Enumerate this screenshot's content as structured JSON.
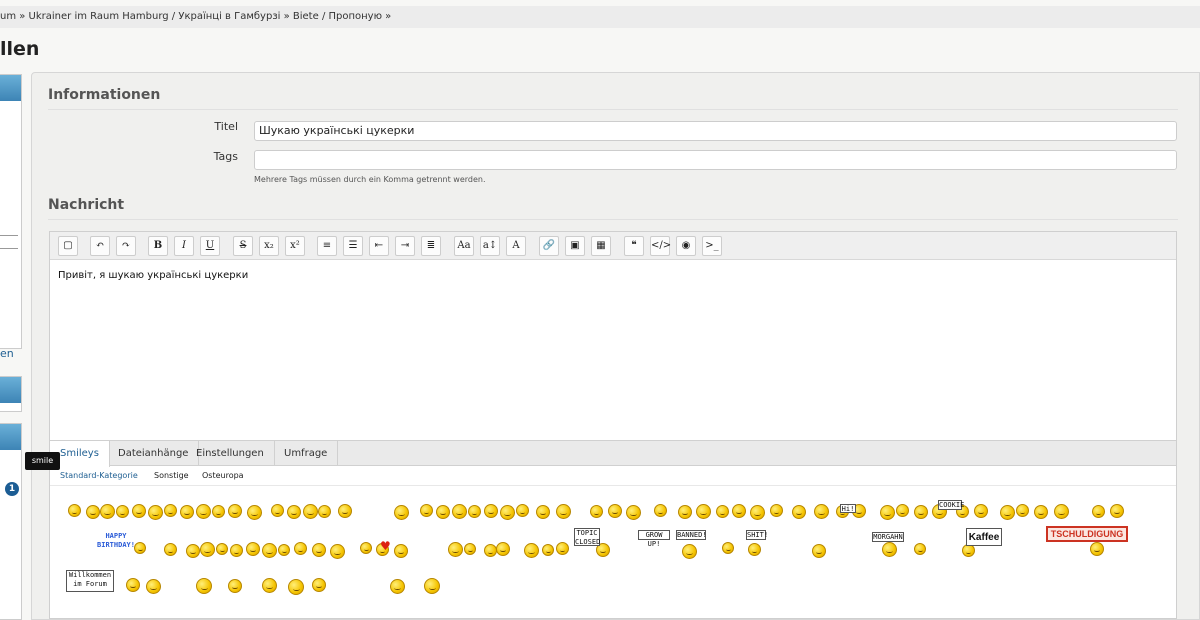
{
  "breadcrumb": "um » Ukrainer im Raum Hamburg / Українці в Гамбурзі » Biete / Пропоную »",
  "page_title": "llen",
  "sidebar": {
    "link_text": "en",
    "badge": "1"
  },
  "informationen": {
    "heading": "Informationen",
    "titel_label": "Titel",
    "titel_value": "Шукаю українські цукерки",
    "tags_label": "Tags",
    "tags_value": "",
    "tags_hint": "Mehrere Tags müssen durch ein Komma getrennt werden."
  },
  "nachricht": {
    "heading": "Nachricht",
    "message_text": "Привіт, я шукаю українські цукерки",
    "toolbar": [
      {
        "name": "source-mode-button",
        "label": "▢"
      },
      {
        "name": "undo-button",
        "label": "↶"
      },
      {
        "name": "redo-button",
        "label": "↷"
      },
      {
        "name": "bold-button",
        "label": "B"
      },
      {
        "name": "italic-button",
        "label": "I"
      },
      {
        "name": "underline-button",
        "label": "U"
      },
      {
        "name": "strikethrough-button",
        "label": "S"
      },
      {
        "name": "subscript-button",
        "label": "x₂"
      },
      {
        "name": "superscript-button",
        "label": "x²"
      },
      {
        "name": "ordered-list-button",
        "label": "≡"
      },
      {
        "name": "unordered-list-button",
        "label": "☰"
      },
      {
        "name": "outdent-button",
        "label": "⇤"
      },
      {
        "name": "indent-button",
        "label": "⇥"
      },
      {
        "name": "align-button",
        "label": "≣"
      },
      {
        "name": "font-family-button",
        "label": "Aa"
      },
      {
        "name": "font-size-button",
        "label": "a↕"
      },
      {
        "name": "font-color-button",
        "label": "A"
      },
      {
        "name": "link-button",
        "label": "🔗"
      },
      {
        "name": "image-button",
        "label": "▣"
      },
      {
        "name": "table-button",
        "label": "▦"
      },
      {
        "name": "quote-button",
        "label": "❝"
      },
      {
        "name": "code-button",
        "label": "</>"
      },
      {
        "name": "spoiler-button",
        "label": "◉"
      },
      {
        "name": "terminal-button",
        "label": ">_"
      }
    ]
  },
  "tabs": [
    "Smileys",
    "Dateianhänge",
    "Einstellungen",
    "Umfrage"
  ],
  "subtabs": [
    "Standard-Kategorie",
    "Sonstige",
    "Osteuropa"
  ],
  "smiley_signs": {
    "happy_line1": "HAPPY",
    "happy_line2": "BIRTHDAY!",
    "topic_closed": "TOPIC CLOSED",
    "grow_up": "GROW UP!",
    "banned": "BANNED!",
    "shit": "SHIT!",
    "morgahn": "MORGAHN",
    "cookie": "COOKIE",
    "hi": "Hi!",
    "kaffee": "Kaffee",
    "tschuldigung": "TSCHULDIGUNG",
    "willkommen": "Willkommen im Forum"
  },
  "tooltip": "smile"
}
